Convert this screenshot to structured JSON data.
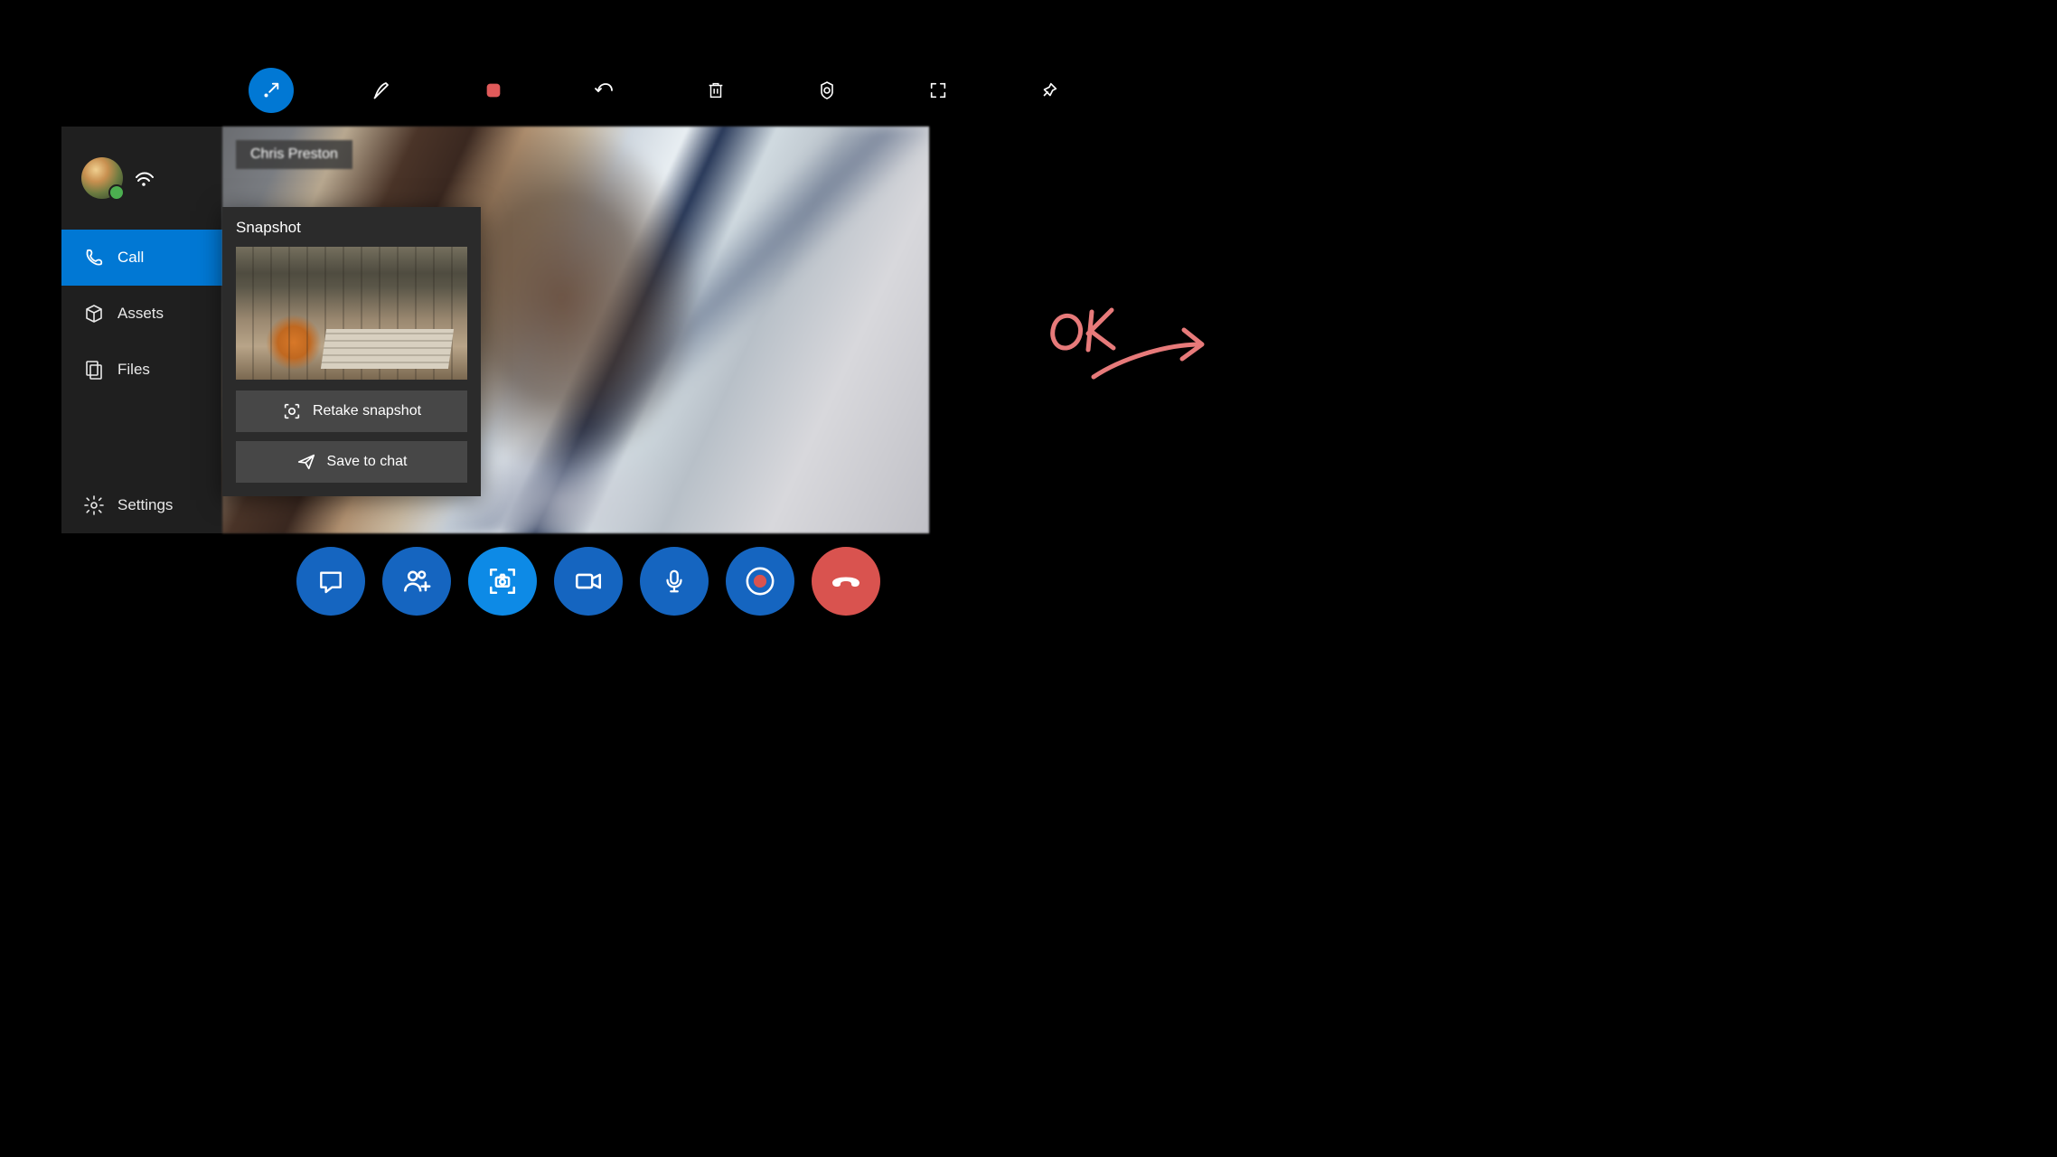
{
  "toolbar": {
    "buttons": [
      {
        "name": "collapse-button",
        "active": true
      },
      {
        "name": "pen-button",
        "active": false
      },
      {
        "name": "stop-button",
        "active": false
      },
      {
        "name": "undo-button",
        "active": false
      },
      {
        "name": "delete-button",
        "active": false
      },
      {
        "name": "target-button",
        "active": false
      },
      {
        "name": "fullscreen-button",
        "active": false
      },
      {
        "name": "pin-button",
        "active": false
      }
    ]
  },
  "sidebar": {
    "status": "online",
    "items": [
      {
        "label": "Call",
        "name": "nav-call",
        "active": true
      },
      {
        "label": "Assets",
        "name": "nav-assets",
        "active": false
      },
      {
        "label": "Files",
        "name": "nav-files",
        "active": false
      }
    ],
    "settings_label": "Settings"
  },
  "call": {
    "caller_name": "Chris Preston"
  },
  "snapshot": {
    "title": "Snapshot",
    "retake_label": "Retake snapshot",
    "save_label": "Save to chat"
  },
  "call_controls": {
    "buttons": [
      "chat-button",
      "add-participant-button",
      "snapshot-button",
      "video-button",
      "mic-button",
      "record-button",
      "hangup-button"
    ]
  },
  "ink": {
    "text": "OK",
    "color": "#e77a7a"
  }
}
